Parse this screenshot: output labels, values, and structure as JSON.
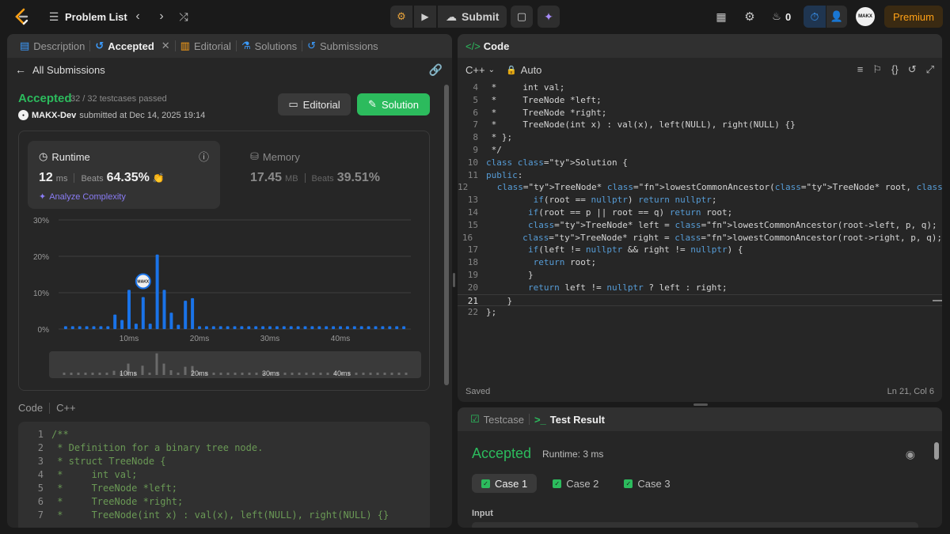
{
  "topbar": {
    "problem_list": "Problem List",
    "submit": "Submit",
    "streak": "0",
    "avatar": "MAKX",
    "premium": "Premium"
  },
  "left_panel": {
    "tabs": [
      {
        "label": "Description"
      },
      {
        "label": "Accepted"
      },
      {
        "label": "Editorial"
      },
      {
        "label": "Solutions"
      },
      {
        "label": "Submissions"
      }
    ],
    "back_label": "All Submissions",
    "status": "Accepted",
    "testcases": "32 / 32 testcases passed",
    "user": "MAKX-Dev",
    "submitted_at": "submitted at Dec 14, 2025 19:14",
    "editorial_btn": "Editorial",
    "solution_btn": "Solution",
    "runtime": {
      "label": "Runtime",
      "value": "12",
      "unit": "ms",
      "beats_label": "Beats",
      "beats": "64.35%",
      "analyze": "Analyze Complexity"
    },
    "memory": {
      "label": "Memory",
      "value": "17.45",
      "unit": "MB",
      "beats_label": "Beats",
      "beats": "39.51%"
    },
    "code_label": "Code",
    "code_lang": "C++",
    "code_lines": [
      {
        "n": "1",
        "t": "/**"
      },
      {
        "n": "2",
        "t": " * Definition for a binary tree node."
      },
      {
        "n": "3",
        "t": " * struct TreeNode {"
      },
      {
        "n": "4",
        "t": " *     int val;"
      },
      {
        "n": "5",
        "t": " *     TreeNode *left;"
      },
      {
        "n": "6",
        "t": " *     TreeNode *right;"
      },
      {
        "n": "7",
        "t": " *     TreeNode(int x) : val(x), left(NULL), right(NULL) {}"
      }
    ]
  },
  "chart_data": {
    "type": "bar",
    "ylabel": "",
    "xlabel": "",
    "yticks": [
      "30%",
      "20%",
      "10%",
      "0%"
    ],
    "ylim": [
      0,
      30
    ],
    "xticks": [
      "10ms",
      "20ms",
      "30ms",
      "40ms"
    ],
    "xtick_values": [
      10,
      20,
      30,
      40
    ],
    "overview_xticks": [
      "10ms",
      "20ms",
      "30ms",
      "40ms"
    ],
    "x": [
      1,
      2,
      3,
      4,
      5,
      6,
      7,
      8,
      9,
      10,
      11,
      12,
      13,
      14,
      15,
      16,
      17,
      18,
      19,
      20,
      21,
      22,
      23,
      24,
      25,
      26,
      27,
      28,
      29,
      30,
      31,
      32,
      33,
      34,
      35,
      36,
      37,
      38,
      39,
      40,
      41,
      42,
      43,
      44,
      45,
      46,
      47,
      48,
      49
    ],
    "values": [
      0.8,
      0.8,
      0.8,
      0.8,
      0.8,
      0.8,
      0.8,
      4,
      2.5,
      10.8,
      1.5,
      8.8,
      1.5,
      20.5,
      10.8,
      4.5,
      1.2,
      7.8,
      8.5,
      0.8,
      0.8,
      0.8,
      0.8,
      0.8,
      0.8,
      0.8,
      0.8,
      0.8,
      0.8,
      0.8,
      0.8,
      0.8,
      0.8,
      0.8,
      0.8,
      0.8,
      0.8,
      0.8,
      0.8,
      0.8,
      0.8,
      0.8,
      0.8,
      0.8,
      0.8,
      0.8,
      0.8,
      0.8,
      0.8
    ],
    "highlight_x": 12,
    "highlight_label": "MAKX",
    "bar_color": "#1a73e8",
    "grid": true
  },
  "editor": {
    "title": "Code",
    "lang": "C++",
    "mode": "Auto",
    "saved": "Saved",
    "cursor": "Ln 21, Col 6",
    "lines": [
      {
        "n": "4",
        "t": " *     int val;",
        "c": "cm"
      },
      {
        "n": "5",
        "t": " *     TreeNode *left;",
        "c": "cm"
      },
      {
        "n": "6",
        "t": " *     TreeNode *right;",
        "c": "cm"
      },
      {
        "n": "7",
        "t": " *     TreeNode(int x) : val(x), left(NULL), right(NULL) {}",
        "c": "cm"
      },
      {
        "n": "8",
        "t": " * };",
        "c": "cm"
      },
      {
        "n": "9",
        "t": " */",
        "c": "cm"
      },
      {
        "n": "10",
        "t": "class Solution {",
        "c": ""
      },
      {
        "n": "11",
        "t": "public:",
        "c": ""
      },
      {
        "n": "12",
        "t": "    TreeNode* lowestCommonAncestor(TreeNode* root, TreeNode* p, TreeNode* q) {",
        "c": ""
      },
      {
        "n": "13",
        "t": "         if(root == nullptr) return nullptr;",
        "c": ""
      },
      {
        "n": "14",
        "t": "        if(root == p || root == q) return root;",
        "c": ""
      },
      {
        "n": "15",
        "t": "        TreeNode* left = lowestCommonAncestor(root->left, p, q);",
        "c": ""
      },
      {
        "n": "16",
        "t": "        TreeNode* right = lowestCommonAncestor(root->right, p, q);",
        "c": ""
      },
      {
        "n": "17",
        "t": "        if(left != nullptr && right != nullptr) {",
        "c": ""
      },
      {
        "n": "18",
        "t": "         return root;",
        "c": ""
      },
      {
        "n": "19",
        "t": "        }",
        "c": ""
      },
      {
        "n": "20",
        "t": "        return left != nullptr ? left : right;",
        "c": ""
      },
      {
        "n": "21",
        "t": "    }",
        "c": ""
      },
      {
        "n": "22",
        "t": "};",
        "c": ""
      }
    ]
  },
  "result_panel": {
    "tab_testcase": "Testcase",
    "tab_result": "Test Result",
    "status": "Accepted",
    "runtime": "Runtime: 3 ms",
    "cases": [
      "Case 1",
      "Case 2",
      "Case 3"
    ],
    "input_label": "Input"
  },
  "colors": {
    "accent_green": "#2cbb5d",
    "premium_orange": "#ffa116",
    "bar_blue": "#1a73e8"
  }
}
